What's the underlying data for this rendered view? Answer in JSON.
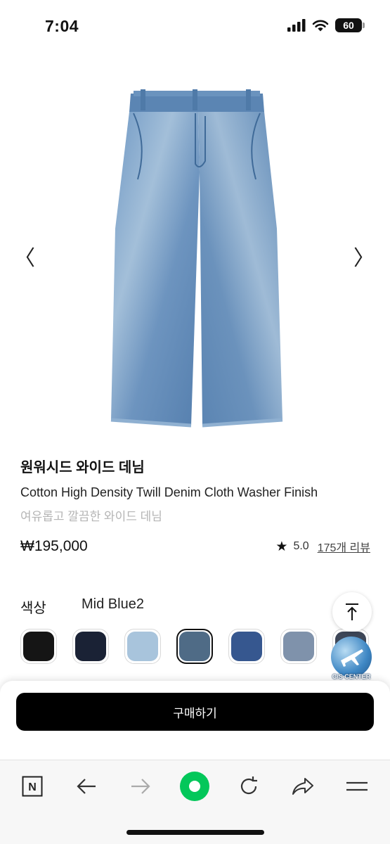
{
  "status_bar": {
    "time": "7:04",
    "battery_level": "60",
    "icons": [
      "signal-icon",
      "wifi-icon",
      "battery-icon"
    ]
  },
  "gallery": {
    "image": "wide-denim-jeans-photo",
    "prev_icon": "chevron-left-icon",
    "next_icon": "chevron-right-icon",
    "prev_glyph": "〈",
    "next_glyph": "〉"
  },
  "product": {
    "name": "원워시드 와이드 데님",
    "english_name": "Cotton High Density Twill Denim Cloth Washer Finish",
    "description": "여유롭고 깔끔한 와이드 데님",
    "price": "₩195,000",
    "rating": "5.0",
    "reviews_label": "175개 리뷰",
    "star_glyph": "★"
  },
  "color": {
    "label": "색상",
    "selected": "Mid Blue2",
    "swatches": [
      {
        "name": "black",
        "hex": "#151515"
      },
      {
        "name": "navy",
        "hex": "#1a2235"
      },
      {
        "name": "light-blue",
        "hex": "#a8c4dc"
      },
      {
        "name": "mid-blue2",
        "hex": "#4f6b86",
        "selected": true
      },
      {
        "name": "blue",
        "hex": "#36578f"
      },
      {
        "name": "grey-blue",
        "hex": "#7f92ab"
      },
      {
        "name": "dark-slate",
        "hex": "#3d4657"
      }
    ]
  },
  "floating": {
    "scroll_top_icon": "arrow-up-to-top-icon",
    "cs_label": "C/S CENTER"
  },
  "purchase": {
    "buy_label": "구매하기"
  },
  "browser": {
    "buttons": [
      "naver-home-icon",
      "back-icon",
      "forward-icon",
      "green-dot-icon",
      "refresh-icon",
      "share-icon",
      "menu-icon"
    ],
    "home_letter": "N"
  },
  "colors": {
    "accent_green": "#03c75a",
    "buy_button_bg": "#000000",
    "muted_text": "#b5b5b5"
  }
}
